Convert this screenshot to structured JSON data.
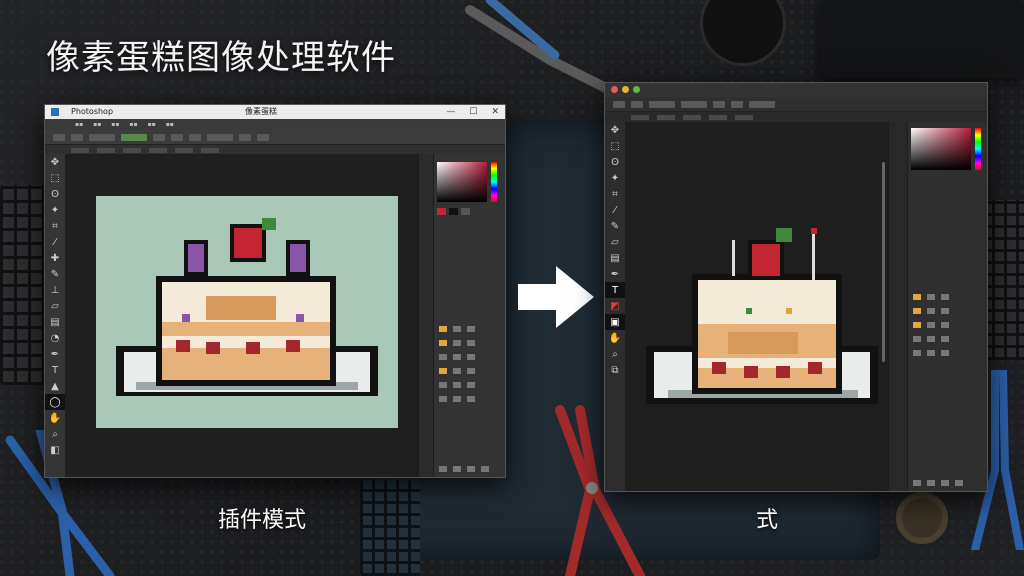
{
  "heading": "像素蛋糕图像处理软件",
  "captions": {
    "left": "插件模式",
    "right": "式"
  },
  "left_window": {
    "title_left": "Photoshop",
    "title_center": "像素蛋糕",
    "window_controls": [
      "—",
      "☐",
      "✕"
    ],
    "tool_icons": [
      "move-icon",
      "marquee-icon",
      "lasso-icon",
      "magic-wand-icon",
      "crop-icon",
      "eyedropper-icon",
      "heal-icon",
      "brush-icon",
      "stamp-icon",
      "history-brush-icon",
      "eraser-icon",
      "gradient-icon",
      "blur-icon",
      "dodge-icon",
      "pen-icon",
      "type-icon",
      "path-select-icon",
      "shape-icon",
      "hand-icon",
      "zoom-icon",
      "color-icon"
    ],
    "canvas_bg": "#a9c8b8"
  },
  "right_window": {
    "tool_icons": [
      "move-icon",
      "marquee-icon",
      "lasso-icon",
      "magic-wand-icon",
      "crop-icon",
      "eyedropper-icon",
      "brush-icon",
      "eraser-icon",
      "gradient-icon",
      "pen-icon",
      "type-icon",
      "shape-icon",
      "hand-icon",
      "zoom-icon",
      "quick-mask-icon",
      "screen-mode-icon",
      "foreground-color-icon",
      "extras-icon",
      "layers-icon"
    ],
    "canvas_bg": "#1e1e1e"
  },
  "colors": {
    "accent_red": "#c0283a",
    "frosting": "#f3ead8",
    "sponge": "#e6b27a",
    "plate": "#e8ecea",
    "strawberry": "#c42631",
    "grape": "#8a54a8"
  }
}
